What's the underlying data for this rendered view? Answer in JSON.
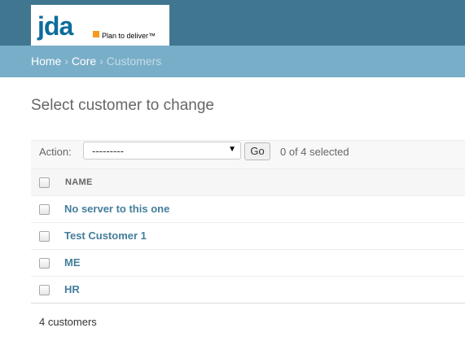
{
  "header": {
    "logo_word": "jda",
    "logo_tagline": "Plan to deliver™"
  },
  "breadcrumbs": {
    "items": [
      "Home",
      "Core"
    ],
    "separator": "›",
    "current": "Customers"
  },
  "page_title": "Select customer to change",
  "actions": {
    "label": "Action:",
    "selected_option": "---------",
    "go_label": "Go",
    "counter": "0 of 4 selected"
  },
  "results": {
    "column_header": "NAME",
    "rows": [
      "No server to this one",
      "Test Customer 1",
      "ME",
      "HR"
    ]
  },
  "paginator": {
    "count": "4 customers"
  },
  "colors": {
    "header_bg": "#417690",
    "breadcrumb_bg": "#79aec8",
    "link": "#447e9b",
    "logo_text": "#0d6c9c",
    "logo_dot": "#f29b1d"
  }
}
